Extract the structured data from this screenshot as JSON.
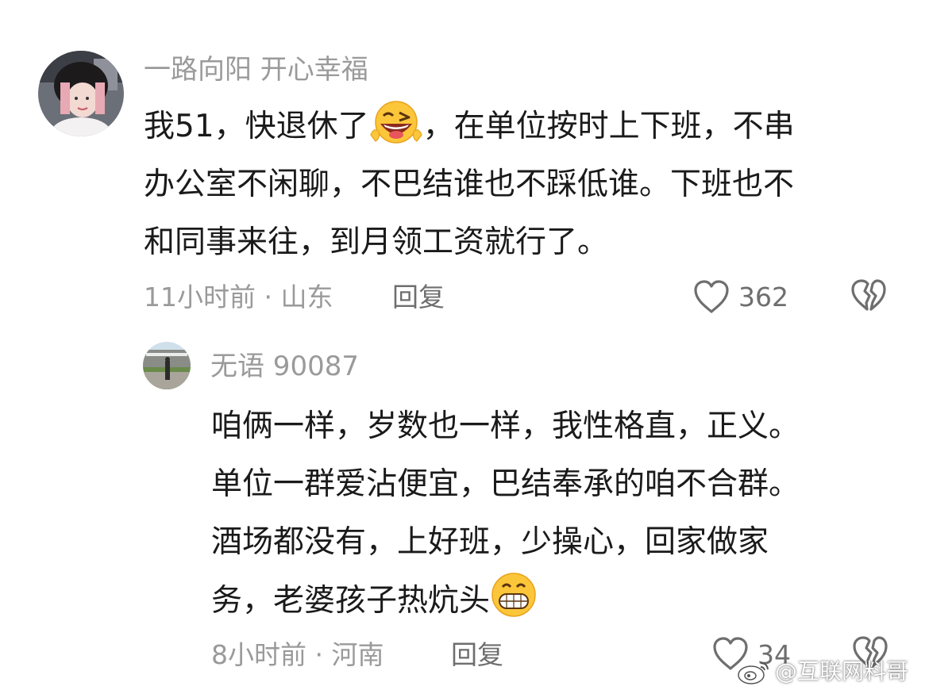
{
  "comments": [
    {
      "username": "一路向阳  开心幸福",
      "text_lines": [
        {
          "pre": "我51，快退休了",
          "emoji": "wink-grin-emoji",
          "post": "，在单位按时上下班，不串"
        },
        {
          "pre": "办公室不闲聊，不巴结谁也不踩低谁。下班也不"
        },
        {
          "pre": "和同事来往，到月领工资就行了。"
        }
      ],
      "time_location": "11小时前 · 山东",
      "reply_label": "回复",
      "like_count": "362"
    },
    {
      "username": "无语 90087",
      "text_lines": [
        {
          "pre": "咱俩一样，岁数也一样，我性格直，正义。"
        },
        {
          "pre": "单位一群爱沾便宜，巴结奉承的咱不合群。"
        },
        {
          "pre": "酒场都没有，上好班，少操心，回家做家"
        },
        {
          "pre": "务，老婆孩子热炕头",
          "emoji": "grin-emoji"
        }
      ],
      "time_location": "8小时前 · 河南",
      "reply_label": "回复",
      "like_count": "34"
    }
  ],
  "watermark": "@互联网料哥",
  "colors": {
    "text": "#1a1a1a",
    "secondary": "#9a9a9a",
    "action": "#6e6e6e",
    "background": "#ffffff"
  }
}
